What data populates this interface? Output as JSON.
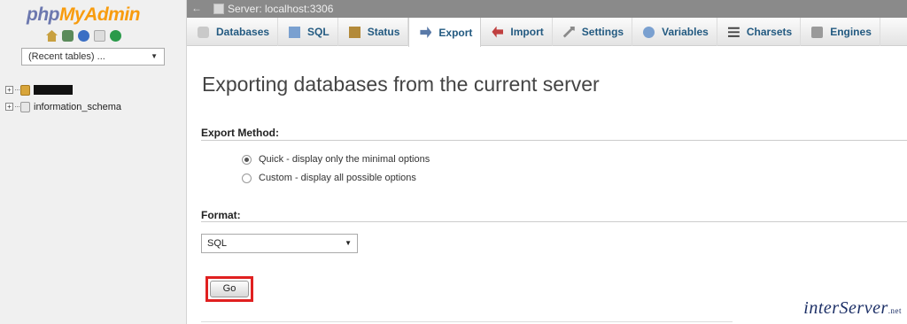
{
  "sidebar": {
    "logo": {
      "part1": "php",
      "part2": "My",
      "part3": "Admin"
    },
    "icons": [
      "home-icon",
      "database-icon",
      "help-icon",
      "documentation-icon",
      "settings-icon"
    ],
    "recent_tables": "(Recent tables) ...",
    "databases": [
      {
        "name": ""
      },
      {
        "name": "information_schema"
      }
    ]
  },
  "topbar": {
    "server": "Server: localhost:3306"
  },
  "tabs": [
    {
      "label": "Databases"
    },
    {
      "label": "SQL"
    },
    {
      "label": "Status"
    },
    {
      "label": "Export"
    },
    {
      "label": "Import"
    },
    {
      "label": "Settings"
    },
    {
      "label": "Variables"
    },
    {
      "label": "Charsets"
    },
    {
      "label": "Engines"
    }
  ],
  "active_tab": "Export",
  "main": {
    "title": "Exporting databases from the current server",
    "export_method": {
      "label": "Export Method:",
      "options": [
        {
          "label": "Quick - display only the minimal options",
          "checked": true
        },
        {
          "label": "Custom - display all possible options",
          "checked": false
        }
      ]
    },
    "format": {
      "label": "Format:",
      "value": "SQL"
    },
    "go_label": "Go"
  },
  "watermark": {
    "text": "interServer",
    "suffix": ".net"
  },
  "colors": {
    "highlight": "#e02020",
    "link": "#235a81",
    "topbar": "#8a8a8a"
  }
}
